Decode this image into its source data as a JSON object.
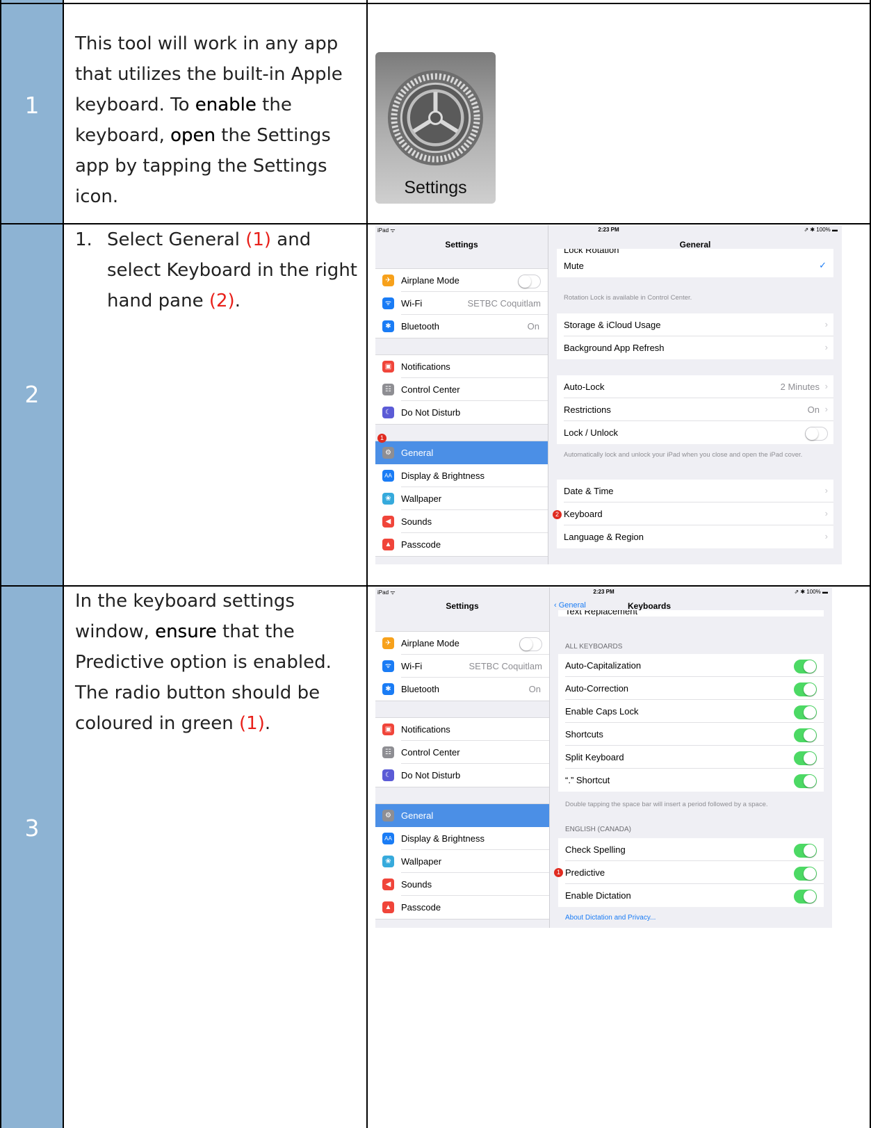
{
  "steps": [
    {
      "number": "1",
      "text_parts": [
        "This tool will work in any app that utilizes the built-in Apple keyboard.  To ",
        "enable",
        " the keyboard, ",
        "open",
        " the Settings app by tapping the Settings icon."
      ],
      "icon_label": "Settings"
    },
    {
      "number": "2",
      "list_marker": "1.",
      "text_parts": [
        "Select General ",
        "(1)",
        " and select Keyboard in the right hand pane ",
        "(2)",
        "."
      ]
    },
    {
      "number": "3",
      "text_parts": [
        "In the keyboard settings window, ",
        "ensure",
        " that the Predictive option is enabled. The radio button should be coloured in green ",
        "(1)",
        "."
      ]
    }
  ],
  "screen1": {
    "status": {
      "left": "iPad ᯤ",
      "time": "2:23 PM",
      "right": "⇗ ✱ 100% ▬"
    },
    "left_title": "Settings",
    "right_title": "General",
    "group1": [
      {
        "label": "Airplane Mode",
        "icon": "airplane-icon",
        "color": "#f7a11b",
        "glyph": "✈",
        "toggle": "off"
      },
      {
        "label": "Wi-Fi",
        "icon": "wifi-icon",
        "color": "#1a7cf5",
        "glyph": "ᯤ",
        "value": "SETBC Coquitlam"
      },
      {
        "label": "Bluetooth",
        "icon": "bluetooth-icon",
        "color": "#1a7cf5",
        "glyph": "✱",
        "value": "On"
      }
    ],
    "group2": [
      {
        "label": "Notifications",
        "icon": "notifications-icon",
        "color": "#f0453a",
        "glyph": "▣"
      },
      {
        "label": "Control Center",
        "icon": "control-center-icon",
        "color": "#8e8e93",
        "glyph": "☷"
      },
      {
        "label": "Do Not Disturb",
        "icon": "moon-icon",
        "color": "#5b5bd6",
        "glyph": "☾"
      }
    ],
    "group3": [
      {
        "label": "General",
        "icon": "gear-icon",
        "color": "#8e8e93",
        "glyph": "⚙",
        "selected": true
      },
      {
        "label": "Display & Brightness",
        "icon": "display-icon",
        "color": "#1a7cf5",
        "glyph": "AA"
      },
      {
        "label": "Wallpaper",
        "icon": "wallpaper-icon",
        "color": "#36aadc",
        "glyph": "❀"
      },
      {
        "label": "Sounds",
        "icon": "sounds-icon",
        "color": "#f0453a",
        "glyph": "◀"
      },
      {
        "label": "Passcode",
        "icon": "lock-icon",
        "color": "#f0453a",
        "glyph": "▲"
      }
    ],
    "right_cut": "Lock Rotation",
    "mute": "Mute",
    "rotation_note": "Rotation Lock is available in Control Center.",
    "storage": "Storage & iCloud Usage",
    "background": "Background App Refresh",
    "autolock": "Auto-Lock",
    "autolock_value": "2 Minutes",
    "restrictions": "Restrictions",
    "restrictions_value": "On",
    "lockunlock": "Lock / Unlock",
    "lock_note": "Automatically lock and unlock your iPad when you close and open the iPad cover.",
    "datetime": "Date & Time",
    "keyboard": "Keyboard",
    "language": "Language & Region",
    "badge1": "1",
    "badge2": "2"
  },
  "screen2": {
    "status": {
      "left": "iPad ᯤ",
      "time": "2:23 PM",
      "right": "⇗ ✱ 100% ▬"
    },
    "left_title": "Settings",
    "back": "General",
    "right_title": "Keyboards",
    "cut_text": "Text Replacement",
    "header_all": "ALL KEYBOARDS",
    "all_rows": [
      "Auto-Capitalization",
      "Auto-Correction",
      "Enable Caps Lock",
      "Shortcuts",
      "Split Keyboard",
      "“.” Shortcut"
    ],
    "period_note": "Double tapping the space bar will insert a period followed by a space.",
    "header_eng": "ENGLISH (CANADA)",
    "eng_rows": [
      "Check Spelling",
      "Predictive",
      "Enable Dictation"
    ],
    "dictation_link": "About Dictation and Privacy...",
    "badge1": "1"
  }
}
